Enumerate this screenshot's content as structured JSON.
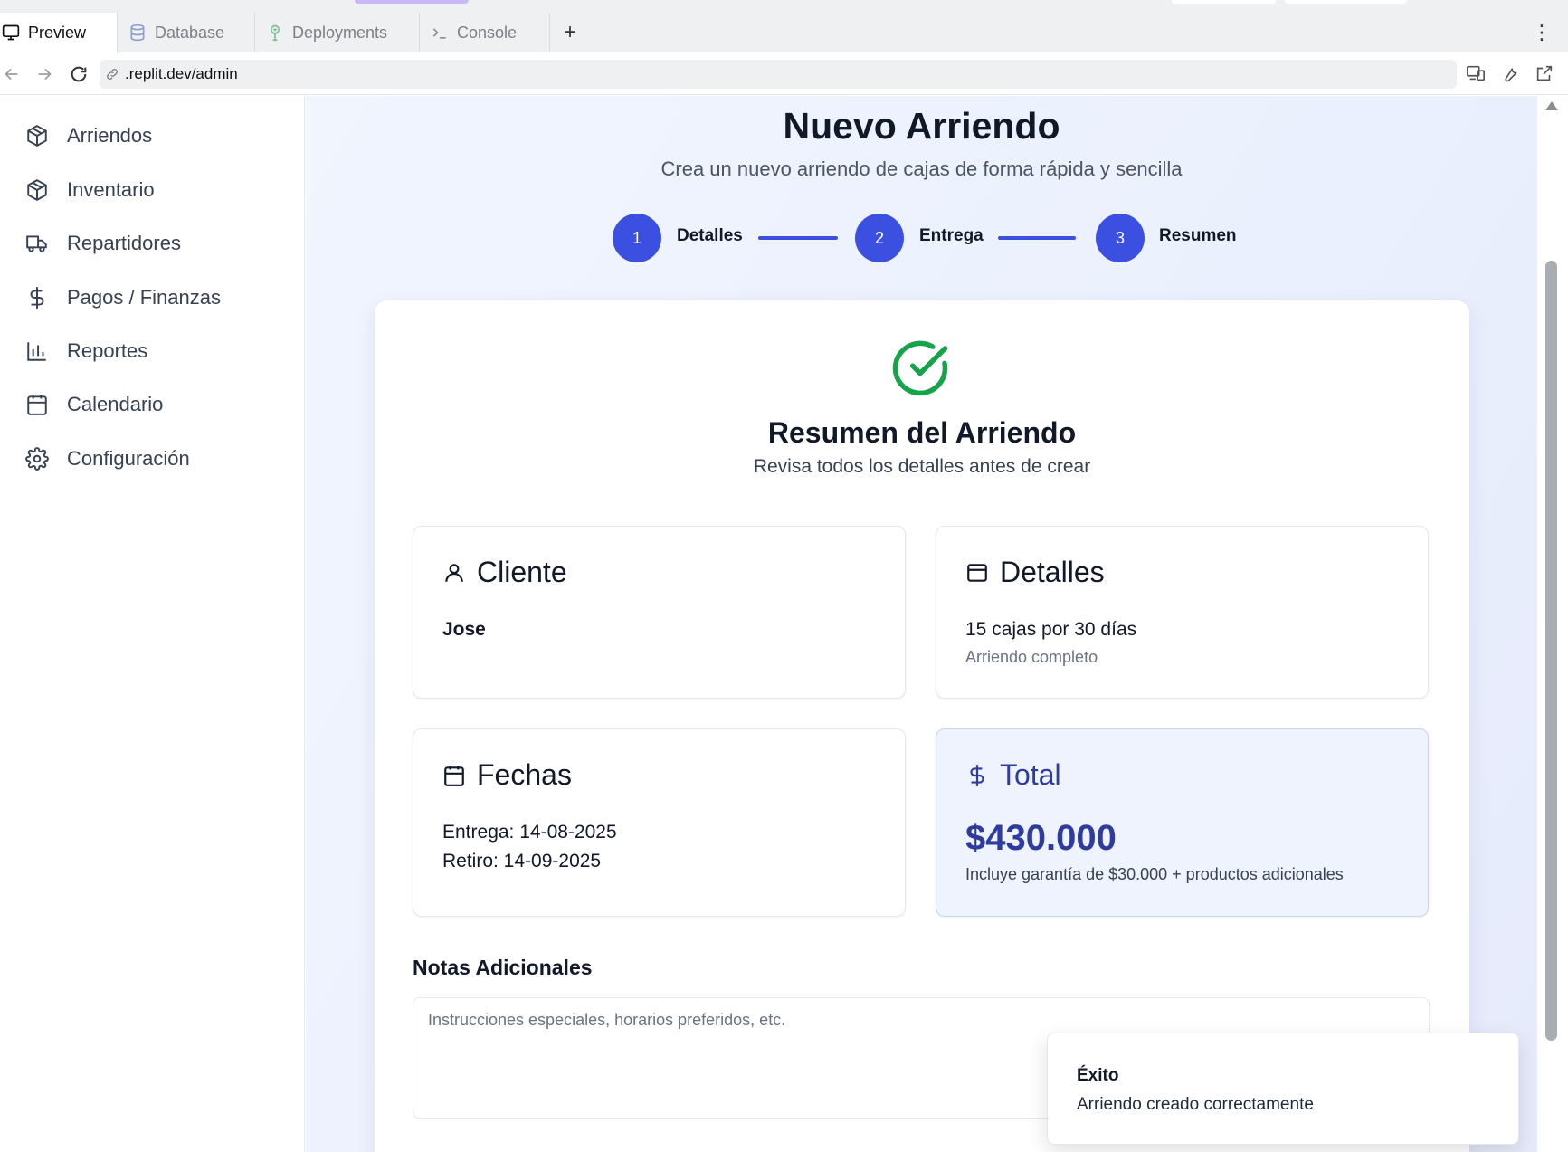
{
  "browser": {
    "tabs": [
      {
        "label": "Preview",
        "icon": "monitor-icon",
        "active": true
      },
      {
        "label": "Database",
        "icon": "database-icon",
        "active": false
      },
      {
        "label": "Deployments",
        "icon": "deploy-icon",
        "active": false
      },
      {
        "label": "Console",
        "icon": "terminal-icon",
        "active": false
      }
    ],
    "add_tab": "+",
    "menu": "⋮",
    "url": ".replit.dev/admin"
  },
  "sidebar": {
    "items": [
      {
        "label": "Arriendos",
        "icon": "box-icon"
      },
      {
        "label": "Inventario",
        "icon": "box-icon"
      },
      {
        "label": "Repartidores",
        "icon": "truck-icon"
      },
      {
        "label": "Pagos / Finanzas",
        "icon": "dollar-icon"
      },
      {
        "label": "Reportes",
        "icon": "bar-chart-icon"
      },
      {
        "label": "Calendario",
        "icon": "calendar-icon"
      },
      {
        "label": "Configuración",
        "icon": "gear-icon"
      }
    ]
  },
  "page": {
    "title": "Nuevo Arriendo",
    "subtitle": "Crea un nuevo arriendo de cajas de forma rápida y sencilla"
  },
  "stepper": {
    "steps": [
      {
        "number": "1",
        "label": "Detalles"
      },
      {
        "number": "2",
        "label": "Entrega"
      },
      {
        "number": "3",
        "label": "Resumen"
      }
    ]
  },
  "summary": {
    "title": "Resumen del Arriendo",
    "subtitle": "Revisa todos los detalles antes de crear",
    "cliente": {
      "heading": "Cliente",
      "name": "Jose"
    },
    "detalles": {
      "heading": "Detalles",
      "line": "15 cajas por 30 días",
      "note": "Arriendo completo"
    },
    "fechas": {
      "heading": "Fechas",
      "entrega": "Entrega: 14-08-2025",
      "retiro": "Retiro: 14-09-2025"
    },
    "total": {
      "heading": "Total",
      "amount": "$430.000",
      "note": "Incluye garantía de $30.000 + productos adicionales"
    },
    "notes": {
      "label": "Notas Adicionales",
      "placeholder": "Instrucciones especiales, horarios preferidos, etc.",
      "value": ""
    }
  },
  "toast": {
    "title": "Éxito",
    "message": "Arriendo creado correctamente"
  },
  "colors": {
    "accent": "#3b4fe0",
    "success": "#16a34a",
    "total_text": "#2f3c9f"
  }
}
